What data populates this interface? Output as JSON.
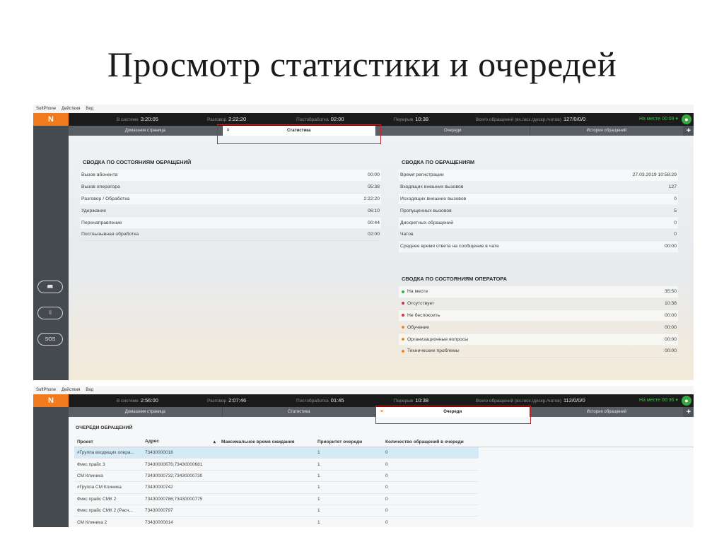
{
  "slide_title": "Просмотр статистики и очередей",
  "shot1": {
    "menu": [
      "SoftPhone",
      "Действия",
      "Вид"
    ],
    "logo": "N",
    "stats": [
      {
        "label": "В системе",
        "value": "3:20:05"
      },
      {
        "label": "Разговор",
        "value": "2:22:20"
      },
      {
        "label": "Постобработка",
        "value": "02:00"
      },
      {
        "label": "Перерыв",
        "value": "10:38"
      },
      {
        "label": "Всего обращений (вх./исх./дискр./чатов)",
        "value": "127/0/0/0"
      }
    ],
    "status": "На месте 00:09 ▾",
    "tabs": [
      "Домашняя страница",
      "Статистика",
      "Очереди",
      "История обращений"
    ],
    "tab_close": "×",
    "tab_add": "+",
    "side_buttons": [
      "📖",
      "⠿",
      "SOS"
    ],
    "calls_state": {
      "title": "СВОДКА ПО СОСТОЯНИЯМ ОБРАЩЕНИЙ",
      "rows": [
        {
          "label": "Вызов абонента",
          "value": "00:00"
        },
        {
          "label": "Вызов оператора",
          "value": "05:38"
        },
        {
          "label": "Разговор / Обработка",
          "value": "2:22:20"
        },
        {
          "label": "Удержание",
          "value": "06:10"
        },
        {
          "label": "Перенаправление",
          "value": "00:44"
        },
        {
          "label": "Поствызывная обработка",
          "value": "02:00"
        }
      ]
    },
    "calls_summary": {
      "title": "СВОДКА ПО ОБРАЩЕНИЯМ",
      "rows": [
        {
          "label": "Время регистрации",
          "value": "27.03.2019 10:58:29"
        },
        {
          "label": "Входящих внешних вызовов",
          "value": "127"
        },
        {
          "label": "Исходящих внешних вызовов",
          "value": "0"
        },
        {
          "label": "Пропущенных вызовов",
          "value": "5"
        },
        {
          "label": "Дискретных обращений",
          "value": "0"
        },
        {
          "label": "Чатов",
          "value": "0"
        },
        {
          "label": "Среднее время ответа на сообщение в чате",
          "value": "00:00"
        }
      ]
    },
    "operator_state": {
      "title": "СВОДКА ПО СОСТОЯНИЯМ ОПЕРАТОРА",
      "rows": [
        {
          "label": "На месте",
          "value": "35:50",
          "color": "#3fae49"
        },
        {
          "label": "Отсутствует",
          "value": "10:38",
          "color": "#d0343a"
        },
        {
          "label": "Не беспокоить",
          "value": "00:00",
          "color": "#d0343a"
        },
        {
          "label": "Обучение",
          "value": "00:00",
          "color": "#f08a24"
        },
        {
          "label": "Организационные вопросы",
          "value": "00:00",
          "color": "#f08a24"
        },
        {
          "label": "Технические проблемы",
          "value": "00:00",
          "color": "#f08a24"
        }
      ]
    }
  },
  "shot2": {
    "menu": [
      "SoftPhone",
      "Действия",
      "Вид"
    ],
    "logo": "N",
    "stats": [
      {
        "label": "В системе",
        "value": "2:56:00"
      },
      {
        "label": "Разговор",
        "value": "2:07:46"
      },
      {
        "label": "Постобработка",
        "value": "01:45"
      },
      {
        "label": "Перерыв",
        "value": "10:38"
      },
      {
        "label": "Всего обращений (вх./исх./дискр./чатов)",
        "value": "112/0/0/0"
      }
    ],
    "status": "На месте 00:36 ▾",
    "tabs": [
      "Домашняя страница",
      "Статистика",
      "Очереди",
      "История обращений"
    ],
    "tab_close": "×",
    "tab_add": "+",
    "queues": {
      "title": "ОЧЕРЕДИ ОБРАЩЕНИЙ",
      "columns": [
        "Проект",
        "Адрес",
        "Максимальное время ожидания",
        "Приоритет очереди",
        "Количество обращений в очереди"
      ],
      "sort_icon": "▴",
      "rows": [
        [
          "#Группа входящих опера...",
          "73430000018",
          "",
          "1",
          "0"
        ],
        [
          "Фикс прайс 3",
          "73430000676;73430000681",
          "",
          "1",
          "0"
        ],
        [
          "СМ Клиника",
          "73430000732;73430000730",
          "",
          "1",
          "0"
        ],
        [
          "#Группа СМ Клиника",
          "73430000742",
          "",
          "1",
          "0"
        ],
        [
          "Фикс прайс СМК 2",
          "73430000786;73430000775",
          "",
          "1",
          "0"
        ],
        [
          "Фикс прайс СМК 2 (Расч...",
          "73430000797",
          "",
          "1",
          "0"
        ],
        [
          "СМ Клиника 2",
          "73430000814",
          "",
          "1",
          "0"
        ]
      ]
    }
  }
}
